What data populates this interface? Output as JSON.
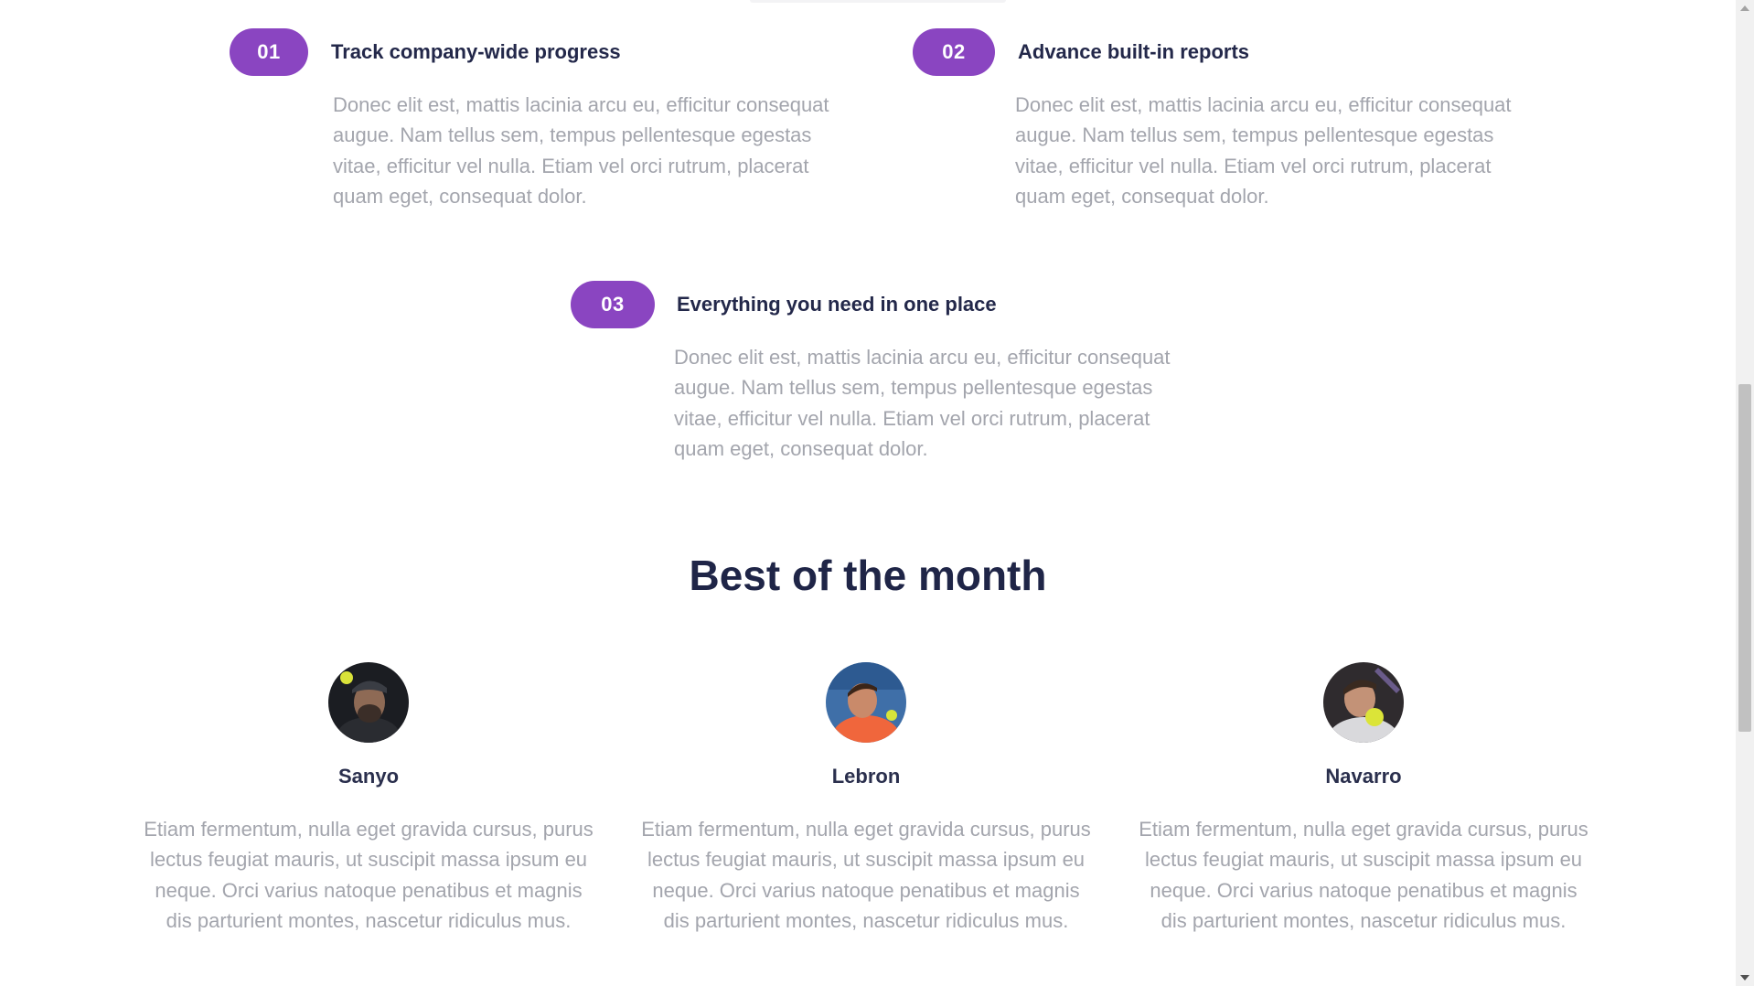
{
  "features": [
    {
      "number": "01",
      "title": "Track company-wide progress",
      "description": "Donec elit est, mattis lacinia arcu eu, efficitur consequat augue. Nam tellus sem, tempus pellentesque egestas vitae, efficitur vel nulla. Etiam vel orci rutrum, placerat quam eget, consequat dolor."
    },
    {
      "number": "02",
      "title": "Advance built-in reports",
      "description": "Donec elit est, mattis lacinia arcu eu, efficitur consequat augue. Nam tellus sem, tempus pellentesque egestas vitae, efficitur vel nulla. Etiam vel orci rutrum, placerat quam eget, consequat dolor."
    },
    {
      "number": "03",
      "title": "Everything you need in one place",
      "description": "Donec elit est, mattis lacinia arcu eu, efficitur consequat augue. Nam tellus sem, tempus pellentesque egestas vitae, efficitur vel nulla. Etiam vel orci rutrum, placerat quam eget, consequat dolor."
    }
  ],
  "best_of_month": {
    "title": "Best of the month",
    "people": [
      {
        "name": "Sanyo",
        "bio": "Etiam fermentum, nulla eget gravida cursus, purus lectus feugiat mauris, ut suscipit massa ipsum eu neque. Orci varius natoque penatibus et magnis dis parturient montes, nascetur ridiculus mus."
      },
      {
        "name": "Lebron",
        "bio": "Etiam fermentum, nulla eget gravida cursus, purus lectus feugiat mauris, ut suscipit massa ipsum eu neque. Orci varius natoque penatibus et magnis dis parturient montes, nascetur ridiculus mus."
      },
      {
        "name": "Navarro",
        "bio": "Etiam fermentum, nulla eget gravida cursus, purus lectus feugiat mauris, ut suscipit massa ipsum eu neque. Orci varius natoque penatibus et magnis dis parturient montes, nascetur ridiculus mus."
      }
    ]
  },
  "colors": {
    "badge": "#8a45c1",
    "heading": "#1f2547",
    "body_text": "#a3a5ad"
  }
}
